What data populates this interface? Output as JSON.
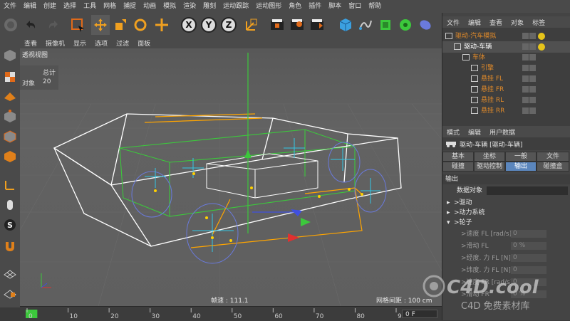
{
  "menubar": [
    "文件",
    "编辑",
    "创建",
    "选择",
    "工具",
    "网格",
    "捕捉",
    "动画",
    "模拟",
    "渲染",
    "雕刻",
    "运动跟踪",
    "运动图形",
    "角色",
    "插件",
    "脚本",
    "窗口",
    "帮助"
  ],
  "toolbar": {
    "axis_x": "X",
    "axis_y": "Y",
    "axis_z": "Z"
  },
  "viewport": {
    "menu": [
      "查看",
      "摄像机",
      "显示",
      "选项",
      "过滤",
      "面板"
    ],
    "title": "透视视图",
    "stats_header": "总计",
    "stats_label": "对象",
    "stats_value": "20",
    "status_speed": "帧速 : 111.1",
    "status_grid": "网格间距 : 100 cm"
  },
  "timeline": {
    "ticks": [
      "0",
      "10",
      "20",
      "30",
      "40",
      "50",
      "60",
      "70",
      "80",
      "90"
    ],
    "frame": "0 F",
    "progress": 0.02
  },
  "object_manager": {
    "menu": [
      "文件",
      "编辑",
      "查看",
      "对象",
      "标签"
    ],
    "items": [
      {
        "name": "驱动-汽车模拟",
        "indent": 0
      },
      {
        "name": "驱动-车辆",
        "indent": 1
      },
      {
        "name": "车体",
        "indent": 2
      },
      {
        "name": "引擎",
        "indent": 3
      },
      {
        "name": "悬挂 FL",
        "indent": 3
      },
      {
        "name": "悬挂 FR",
        "indent": 3
      },
      {
        "name": "悬挂 RL",
        "indent": 3
      },
      {
        "name": "悬挂 RR",
        "indent": 3
      }
    ]
  },
  "attributes": {
    "menu": [
      "模式",
      "编辑",
      "用户数据"
    ],
    "title": "驱动-车辆 [驱动-车辆]",
    "tabs_row1": [
      "基本",
      "坐标",
      "一般",
      "文件"
    ],
    "tabs_row2": [
      "碰撞",
      "驱动控制",
      "输出",
      "碰撞盒"
    ],
    "active_tab": "输出",
    "section_title": "输出",
    "data_object_label": "数据对象",
    "groups": [
      ">驱动",
      ">动力系统",
      ">轮子"
    ],
    "params": [
      {
        "label": ">速度 FL [rad/s]",
        "value": "0"
      },
      {
        "label": ">滑动 FL",
        "value": "0 %"
      },
      {
        "label": ">经度. 力 FL [N]",
        "value": "0"
      },
      {
        "label": ">纬度. 力 FL [N]",
        "value": "0"
      },
      {
        "label": ">速度 FR [rad/s]",
        "value": "0"
      },
      {
        "label": ">滑动 FR",
        "value": "0 %"
      }
    ]
  },
  "watermark": {
    "logo": "C4D.cool",
    "subtitle": "C4D 免费素材库"
  },
  "colors": {
    "accent_orange": "#e08a2a",
    "active_tab": "#5b86bd",
    "wire_white": "#ffffff",
    "wire_green": "#3cc83c",
    "wire_orange": "#ffa500",
    "wire_cyan": "#32c8e6"
  }
}
